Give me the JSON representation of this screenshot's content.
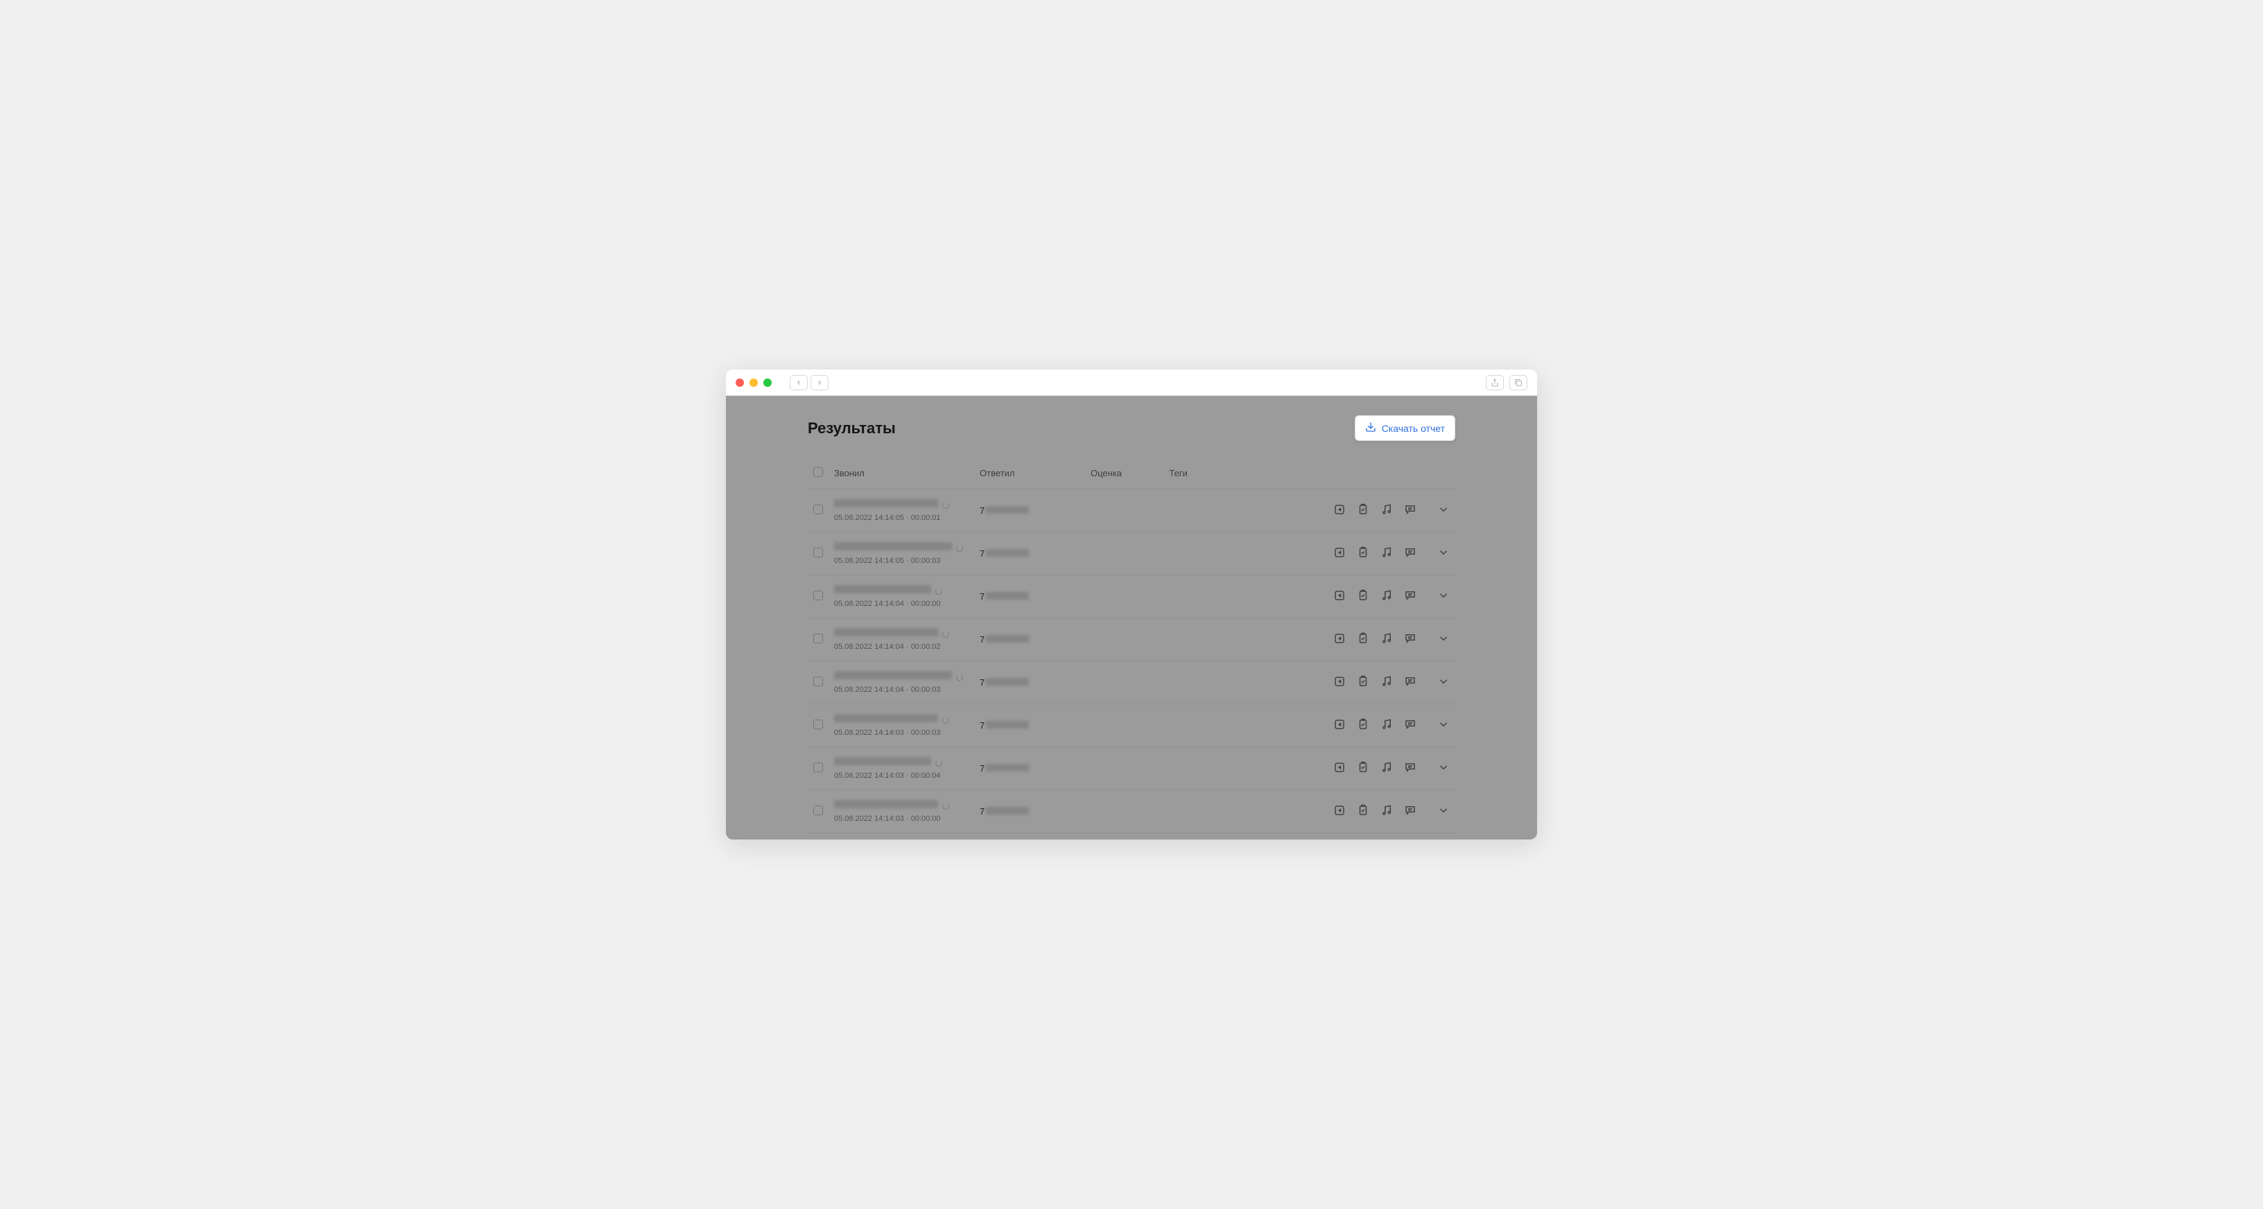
{
  "header": {
    "title": "Результаты"
  },
  "buttons": {
    "download_report": "Скачать отчет"
  },
  "columns": {
    "caller": "Звонил",
    "answered": "Ответил",
    "rating": "Оценка",
    "tags": "Теги"
  },
  "rows": [
    {
      "name_redacted": true,
      "timestamp": "05.08.2022 14:14:05",
      "duration": "00:00:01",
      "phone_prefix": "7",
      "phone_redacted": true
    },
    {
      "name_redacted": true,
      "timestamp": "05.08.2022 14:14:05",
      "duration": "00:00:03",
      "phone_prefix": "7",
      "phone_redacted": true
    },
    {
      "name_redacted": true,
      "timestamp": "05.08.2022 14:14:04",
      "duration": "00:00:00",
      "phone_prefix": "7",
      "phone_redacted": true
    },
    {
      "name_redacted": true,
      "timestamp": "05.08.2022 14:14:04",
      "duration": "00:00:02",
      "phone_prefix": "7",
      "phone_redacted": true
    },
    {
      "name_redacted": true,
      "timestamp": "05.08.2022 14:14:04",
      "duration": "00:00:03",
      "phone_prefix": "7",
      "phone_redacted": true
    },
    {
      "name_redacted": true,
      "timestamp": "05.08.2022 14:14:03",
      "duration": "00:00:03",
      "phone_prefix": "7",
      "phone_redacted": true
    },
    {
      "name_redacted": true,
      "timestamp": "05.08.2022 14:14:03",
      "duration": "00:00:04",
      "phone_prefix": "7",
      "phone_redacted": true
    },
    {
      "name_redacted": true,
      "timestamp": "05.08.2022 14:14:03",
      "duration": "00:00:00",
      "phone_prefix": "7",
      "phone_redacted": true
    }
  ],
  "icons": {
    "share": "share-icon",
    "clipboard": "clipboard-icon",
    "music": "music-icon",
    "comment": "comment-icon",
    "chevron": "chevron-down-icon"
  }
}
